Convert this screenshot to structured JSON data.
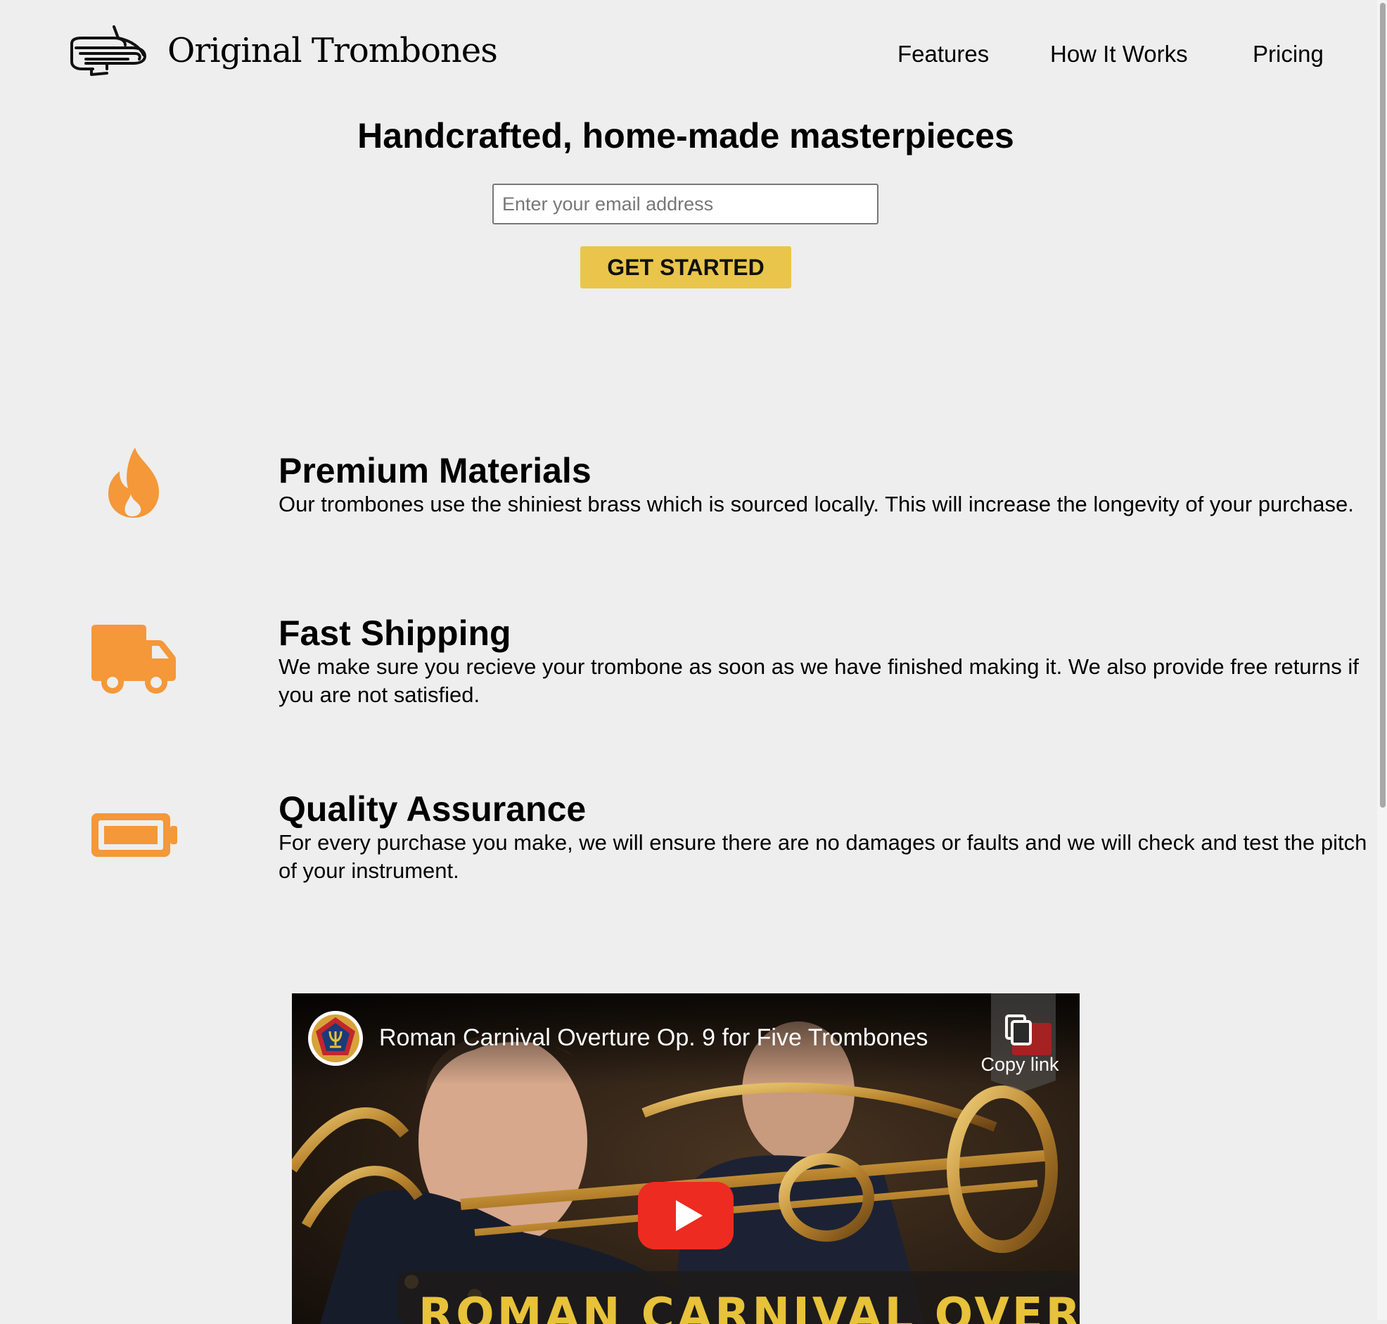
{
  "colors": {
    "background": "#eeeeee",
    "accent_orange": "#f49839",
    "cta_yellow": "#eac54b",
    "video_caption_yellow": "#e7c23a",
    "youtube_red": "#ee2b20"
  },
  "header": {
    "logo_icon": "trombone-icon",
    "logo_text": "Original Trombones",
    "nav": [
      {
        "label": "Features"
      },
      {
        "label": "How It Works"
      },
      {
        "label": "Pricing"
      }
    ]
  },
  "hero": {
    "title": "Handcrafted, home-made masterpieces",
    "email_placeholder": "Enter your email address",
    "email_value": "",
    "cta_label": "GET STARTED"
  },
  "features": [
    {
      "icon": "fire-icon",
      "title": "Premium Materials",
      "description": "Our trombones use the shiniest brass which is sourced locally. This will increase the longevity of your purchase."
    },
    {
      "icon": "truck-icon",
      "title": "Fast Shipping",
      "description": "We make sure you recieve your trombone as soon as we have finished making it. We also provide free returns if you are not satisfied."
    },
    {
      "icon": "battery-full-icon",
      "title": "Quality Assurance",
      "description": "For every purchase you make, we will ensure there are no damages or faults and we will check and test the pitch of your instrument."
    }
  ],
  "video": {
    "title": "Roman Carnival Overture Op. 9 for Five Trombones",
    "copy_link_label": "Copy link",
    "caption": "ROMAN CARNIVAL OVERTURE",
    "play_icon": "play-icon",
    "channel_icon": "lyre-crest-icon"
  }
}
